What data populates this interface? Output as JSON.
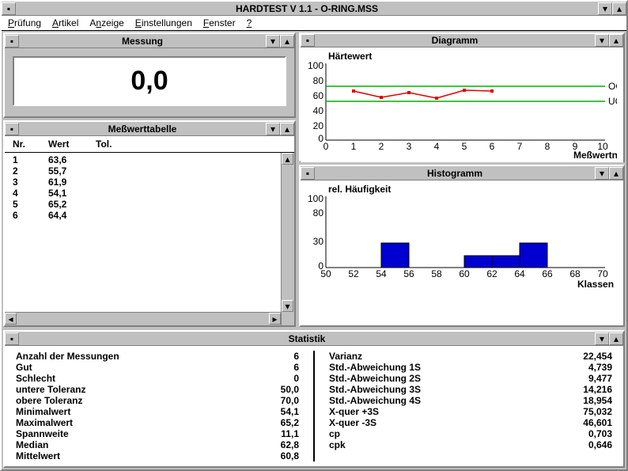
{
  "app": {
    "title": "HARDTEST V 1.1 - O-RING.MSS"
  },
  "menu": [
    "Prüfung",
    "Artikel",
    "Anzeige",
    "Einstellungen",
    "Fenster",
    "?"
  ],
  "messung": {
    "title": "Messung",
    "value": "0,0"
  },
  "tabelle": {
    "title": "Meßwerttabelle",
    "h1": "Nr.",
    "h2": "Wert",
    "h3": "Tol.",
    "rows": [
      [
        "1",
        "63,6",
        ""
      ],
      [
        "2",
        "55,7",
        ""
      ],
      [
        "3",
        "61,9",
        ""
      ],
      [
        "4",
        "54,1",
        ""
      ],
      [
        "5",
        "65,2",
        ""
      ],
      [
        "6",
        "64,4",
        ""
      ]
    ]
  },
  "diagramm": {
    "title": "Diagramm",
    "ylabel": "Härtewert",
    "xlabel": "Meßwertnr.",
    "og": "OG",
    "ug": "UG"
  },
  "histogramm": {
    "title": "Histogramm",
    "ylabel": "rel. Häufigkeit",
    "xlabel": "Klassen"
  },
  "statistik": {
    "title": "Statistik",
    "l": [
      [
        "Anzahl der Messungen",
        "6"
      ],
      [
        "Gut",
        "6"
      ],
      [
        "Schlecht",
        "0"
      ],
      [
        "untere Toleranz",
        "50,0"
      ],
      [
        "obere Toleranz",
        "70,0"
      ],
      [
        "Minimalwert",
        "54,1"
      ],
      [
        "Maximalwert",
        "65,2"
      ],
      [
        "Spannweite",
        "11,1"
      ],
      [
        "Median",
        "62,8"
      ],
      [
        "Mittelwert",
        "60,8"
      ]
    ],
    "r": [
      [
        "Varianz",
        "22,454"
      ],
      [
        "Std.-Abweichung 1S",
        "4,739"
      ],
      [
        "Std.-Abweichung 2S",
        "9,477"
      ],
      [
        "Std.-Abweichung 3S",
        "14,216"
      ],
      [
        "Std.-Abweichung 4S",
        "18,954"
      ],
      [
        "X-quer +3S",
        "75,032"
      ],
      [
        "X-quer  -3S",
        "46,601"
      ],
      [
        "cp",
        "0,703"
      ],
      [
        "cpk",
        "0,646"
      ]
    ]
  },
  "chart_data": [
    {
      "type": "line",
      "title": "Diagramm",
      "ylabel": "Härtewert",
      "xlabel": "Meßwertnr.",
      "ylim": [
        0,
        100
      ],
      "xlim": [
        0,
        10
      ],
      "og": 70,
      "ug": 50,
      "series": [
        {
          "name": "Härtewert",
          "x": [
            1,
            2,
            3,
            4,
            5,
            6
          ],
          "values": [
            63.6,
            55.7,
            61.9,
            54.1,
            65.2,
            64.4
          ]
        }
      ]
    },
    {
      "type": "bar",
      "title": "Histogramm",
      "ylabel": "rel. Häufigkeit",
      "xlabel": "Klassen",
      "ylim": [
        0,
        100
      ],
      "categories": [
        50,
        52,
        54,
        56,
        58,
        60,
        62,
        64,
        66,
        68,
        70
      ],
      "values": [
        0,
        0,
        34,
        0,
        0,
        17,
        17,
        34,
        0,
        0
      ]
    }
  ]
}
